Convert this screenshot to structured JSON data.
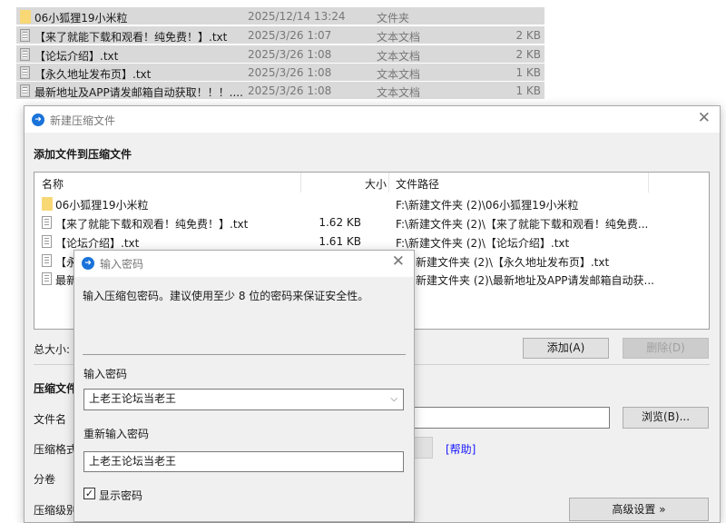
{
  "explorer": {
    "rows": [
      {
        "icon": "folder-icon",
        "name": "06小狐狸19小米粒",
        "date": "2025/12/14 13:24",
        "type": "文件夹",
        "size": ""
      },
      {
        "icon": "file-icon",
        "name": "【来了就能下载和观看！纯免费！】.txt",
        "date": "2025/3/26 1:07",
        "type": "文本文档",
        "size": "2 KB"
      },
      {
        "icon": "file-icon",
        "name": "【论坛介绍】.txt",
        "date": "2025/3/26 1:08",
        "type": "文本文档",
        "size": "2 KB"
      },
      {
        "icon": "file-icon",
        "name": "【永久地址发布页】.txt",
        "date": "2025/3/26 1:08",
        "type": "文本文档",
        "size": "1 KB"
      },
      {
        "icon": "file-icon",
        "name": "最新地址及APP请发邮箱自动获取！！！....",
        "date": "2025/3/26 1:08",
        "type": "文本文档",
        "size": "1 KB"
      }
    ]
  },
  "main_dialog": {
    "title": "新建压缩文件",
    "close": "✕",
    "heading": "添加文件到压缩文件",
    "columns": {
      "name": "名称",
      "size": "大小",
      "path": "文件路径"
    },
    "files": [
      {
        "icon": "folder-icon",
        "name": "06小狐狸19小米粒",
        "size": "",
        "path": "F:\\新建文件夹 (2)\\06小狐狸19小米粒"
      },
      {
        "icon": "file-icon",
        "name": "【来了就能下载和观看！纯免费！】.txt",
        "size": "1.62 KB",
        "path": "F:\\新建文件夹 (2)\\【来了就能下载和观看！纯免费..."
      },
      {
        "icon": "file-icon",
        "name": "【论坛介绍】.txt",
        "size": "1.61 KB",
        "path": "F:\\新建文件夹 (2)\\【论坛介绍】.txt"
      },
      {
        "icon": "file-icon",
        "name": "【永",
        "size": "",
        "path": "新建文件夹 (2)\\【永久地址发布页】.txt"
      },
      {
        "icon": "file-icon",
        "name": "最新",
        "size": "",
        "path": "新建文件夹 (2)\\最新地址及APP请发邮箱自动获..."
      }
    ],
    "total_size_label": "总大小: 4",
    "add_button": "添加(A)",
    "delete_button": "删除(D)",
    "section_title": "压缩文件",
    "filename_label": "文件名",
    "browse_button": "浏览(B)...",
    "format_label": "压缩格式",
    "help_link": "[帮助]",
    "split_label": "分卷",
    "level_label": "压缩级别",
    "advanced_button": "高级设置 »"
  },
  "password_dialog": {
    "title": "输入密码",
    "close": "✕",
    "hint": "输入压缩包密码。建议使用至少 8 位的密码来保证安全性。",
    "password_label": "输入密码",
    "password_value": "上老王论坛当老王",
    "confirm_label": "重新输入密码",
    "confirm_value": "上老王论坛当老王",
    "show_password_label": "显示密码",
    "show_password_checked": true
  }
}
